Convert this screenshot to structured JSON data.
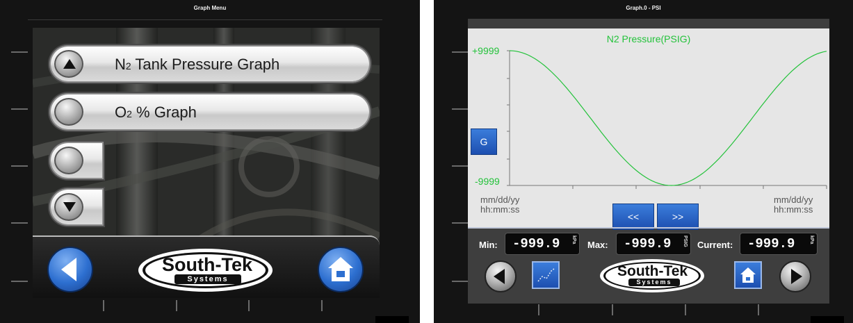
{
  "left_window": {
    "title": "Graph Menu",
    "menu_items": [
      {
        "label_main": "N",
        "label_sub": "2",
        "label_rest": " Tank Pressure Graph",
        "icon": "up-arrow-icon"
      },
      {
        "label_main": "O",
        "label_sub": "2",
        "label_rest": " % Graph",
        "icon": "blank-knob-icon"
      },
      {
        "label_main": "",
        "label_sub": "",
        "label_rest": "",
        "icon": "blank-knob-icon"
      },
      {
        "label_main": "",
        "label_sub": "",
        "label_rest": "",
        "icon": "down-arrow-icon"
      }
    ],
    "back_icon": "back-arrow-icon",
    "home_icon": "home-icon",
    "logo": {
      "main": "South-Tek",
      "sub": "Systems"
    }
  },
  "right_window": {
    "title": "Graph.0 - PSI",
    "graph": {
      "title": "N2 Pressure(PSIG)",
      "y_max_label": "+9999",
      "y_min_label": "-9999",
      "g_button": "G",
      "start_date": "mm/dd/yy",
      "start_time": "hh:mm:ss",
      "end_date": "mm/dd/yy",
      "end_time": "hh:mm:ss",
      "prev_label": "<<",
      "next_label": ">>",
      "line_color": "#23c23a"
    },
    "readouts": {
      "min_label": "Min:",
      "min_value": "-999.9",
      "min_unit": "kPa",
      "max_label": "Max:",
      "max_value": "-999.9",
      "max_unit": "PSIG",
      "current_label": "Current:",
      "current_value": "-999.9",
      "current_unit": "kPa"
    },
    "logo": {
      "main": "South-Tek",
      "sub": "Systems"
    },
    "icons": [
      "left-arrow-icon",
      "trend-icon",
      "home-icon",
      "right-arrow-icon"
    ]
  }
}
